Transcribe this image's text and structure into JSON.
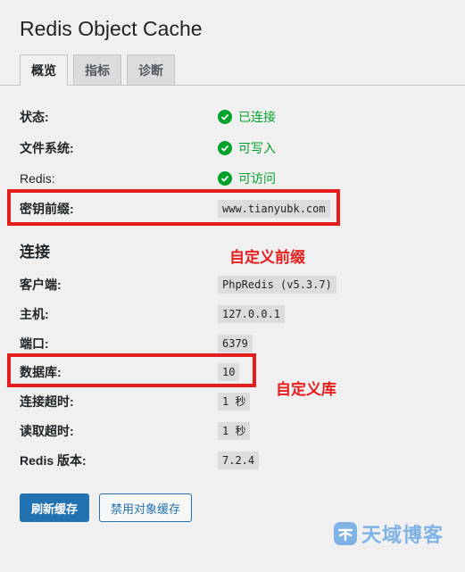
{
  "page": {
    "title": "Redis Object Cache"
  },
  "tabs": [
    {
      "label": "概览",
      "active": true
    },
    {
      "label": "指标",
      "active": false
    },
    {
      "label": "诊断",
      "active": false
    }
  ],
  "status_rows": [
    {
      "label": "状态:",
      "value": "已连接",
      "icon": "check-circle-icon"
    },
    {
      "label": "文件系统:",
      "value": "可写入",
      "icon": "check-circle-icon"
    },
    {
      "label": "Redis:",
      "value": "可访问",
      "icon": "check-circle-icon"
    }
  ],
  "prefix_row": {
    "label": "密钥前缀:",
    "value": "www.tianyubk.com"
  },
  "connection": {
    "title": "连接",
    "rows": [
      {
        "label": "客户端:",
        "value": "PhpRedis (v5.3.7)"
      },
      {
        "label": "主机:",
        "value": "127.0.0.1"
      },
      {
        "label": "端口:",
        "value": "6379"
      },
      {
        "label": "数据库:",
        "value": "10"
      },
      {
        "label": "连接超时:",
        "value": "1 秒"
      },
      {
        "label": "读取超时:",
        "value": "1 秒"
      },
      {
        "label": "Redis 版本:",
        "value": "7.2.4"
      }
    ]
  },
  "annotations": {
    "prefix_note": "自定义前缀",
    "database_note": "自定义库"
  },
  "buttons": {
    "flush": "刷新缓存",
    "disable": "禁用对象缓存"
  },
  "watermark": {
    "text": "天域博客",
    "logo_icon": "tianyu-logo-icon"
  },
  "colors": {
    "success": "#00a32a",
    "primary": "#2271b1",
    "annotation_red": "#e61d1d",
    "background": "#f0f0f1"
  }
}
